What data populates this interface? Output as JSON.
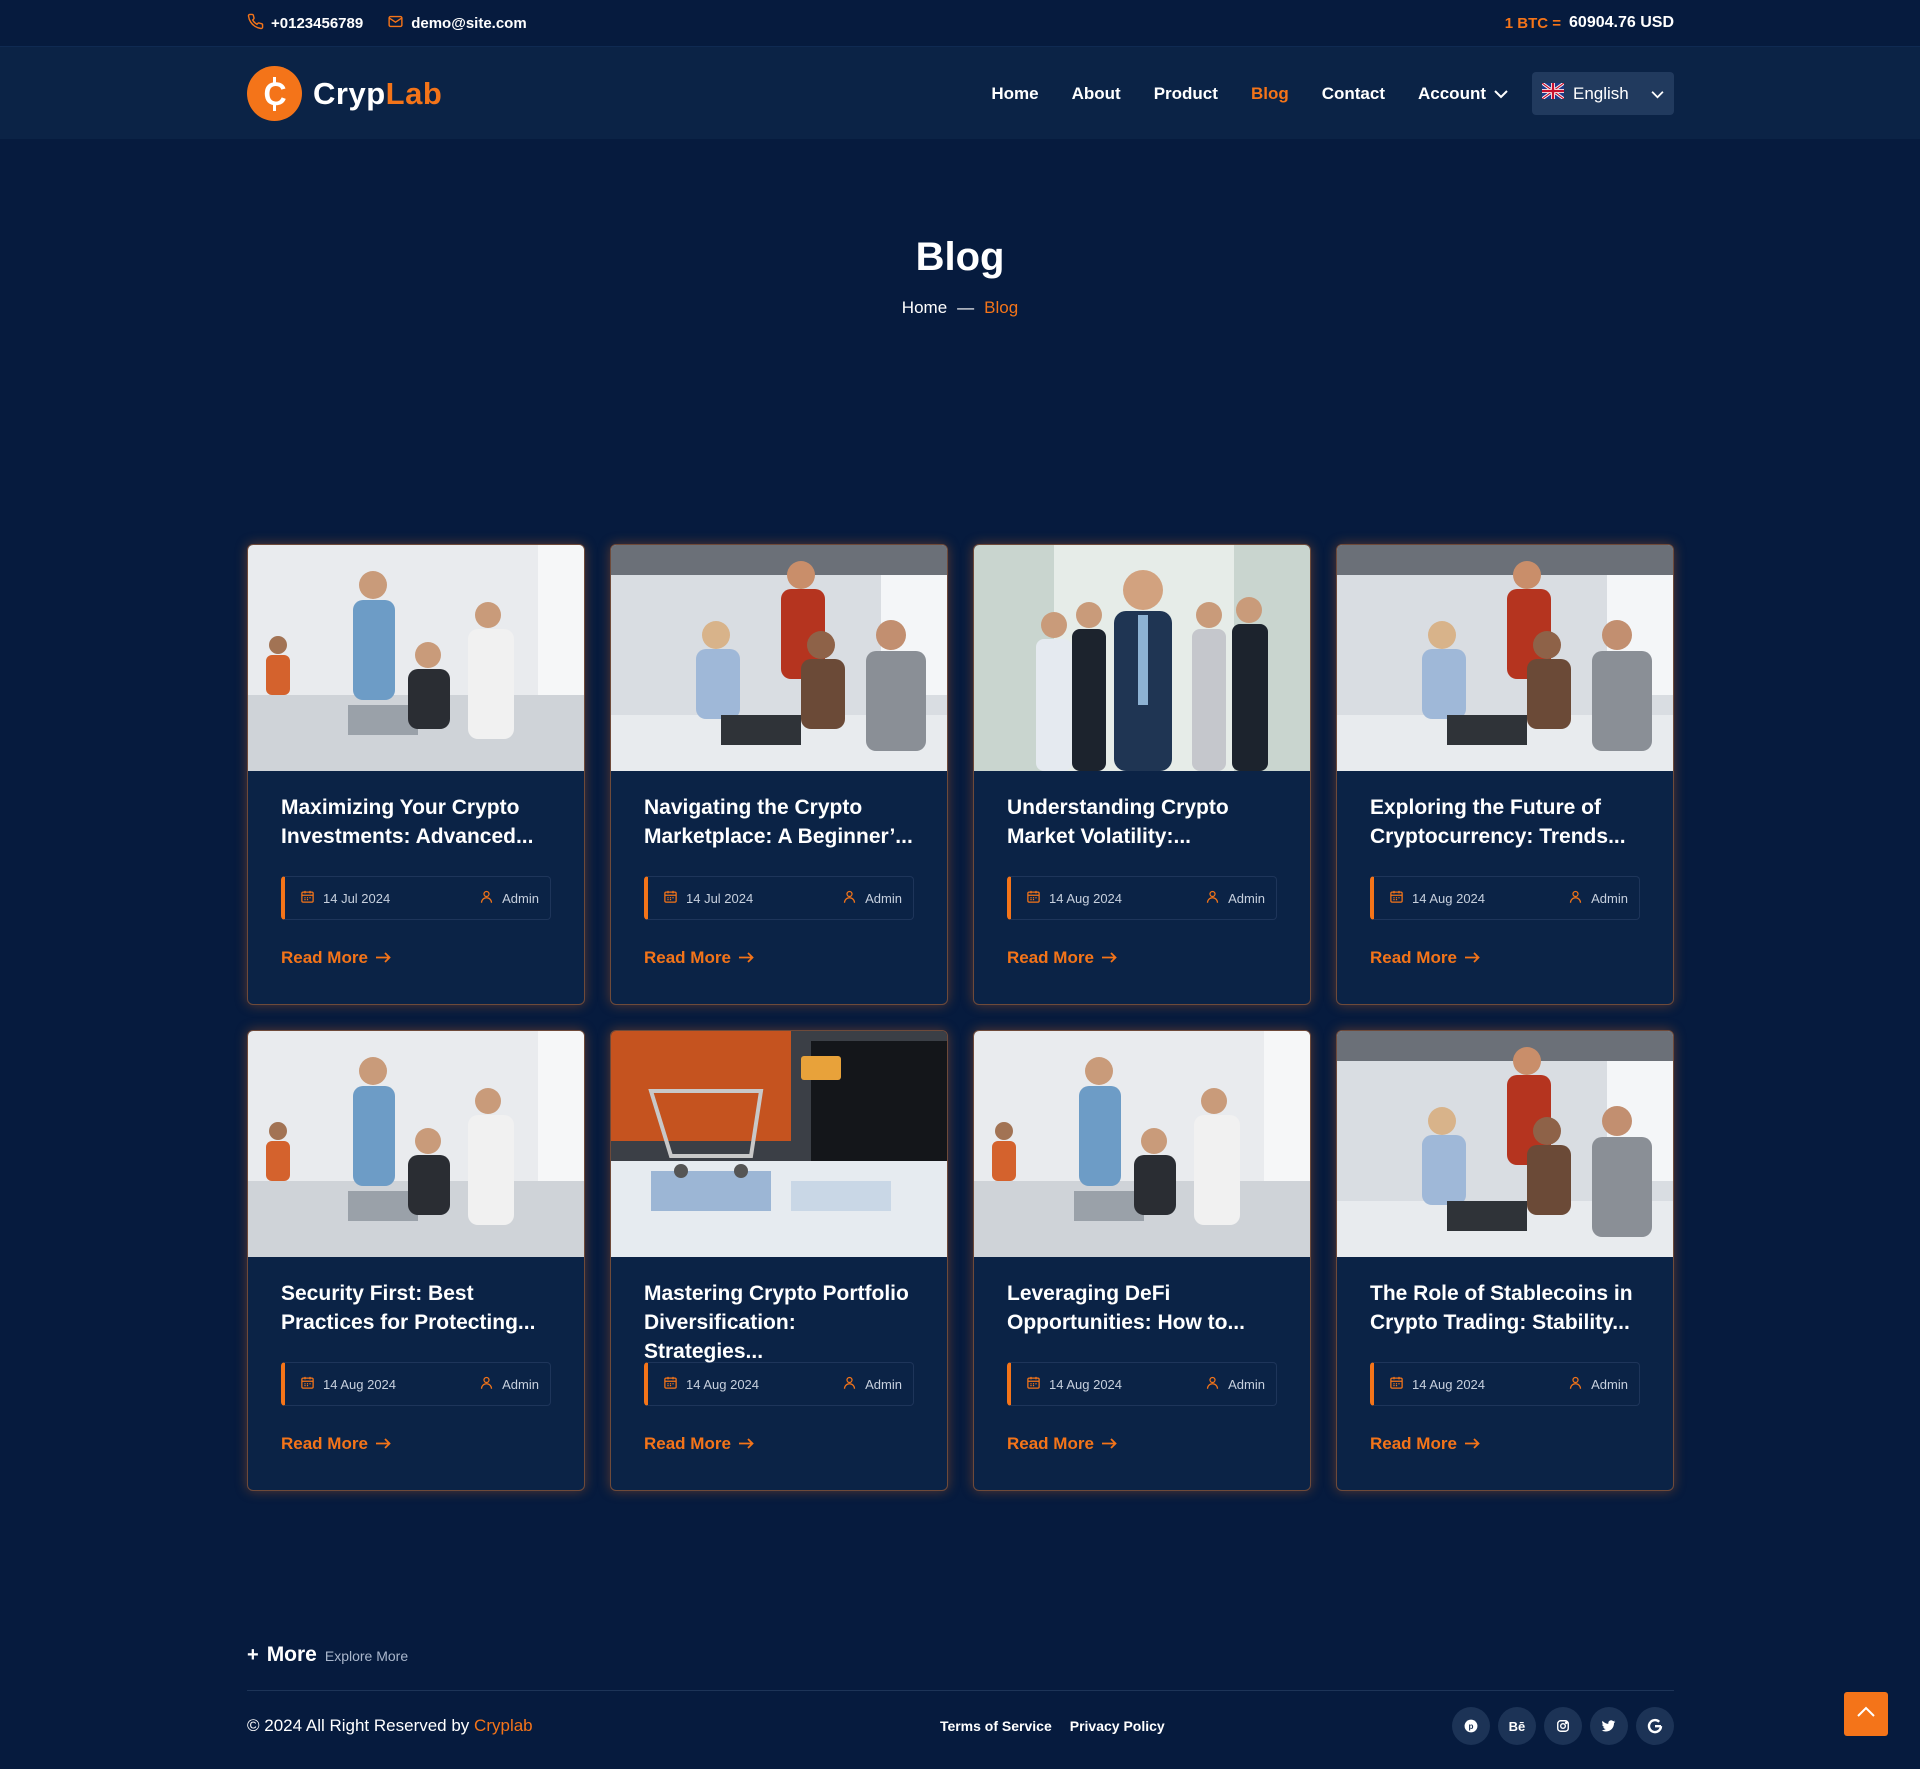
{
  "topbar": {
    "phone": "+0123456789",
    "email": "demo@site.com",
    "btc_label": "1 BTC =",
    "btc_value": "60904.76 USD"
  },
  "header": {
    "logo_part1": "Cryp",
    "logo_part2": "Lab",
    "nav": [
      "Home",
      "About",
      "Product",
      "Blog",
      "Contact",
      "Account"
    ],
    "active_nav": "Blog",
    "language": "English"
  },
  "hero": {
    "title": "Blog",
    "crumb_home": "Home",
    "crumb_sep": "—",
    "crumb_current": "Blog"
  },
  "posts": [
    {
      "title": "Maximizing Your Crypto Investments: Advanced...",
      "date": "14 Jul 2024",
      "author": "Admin",
      "read_more": "Read More"
    },
    {
      "title": "Navigating the Crypto Marketplace: A Beginner’...",
      "date": "14 Jul 2024",
      "author": "Admin",
      "read_more": "Read More"
    },
    {
      "title": "Understanding Crypto Market Volatility:...",
      "date": "14 Aug 2024",
      "author": "Admin",
      "read_more": "Read More"
    },
    {
      "title": "Exploring the Future of Cryptocurrency: Trends...",
      "date": "14 Aug 2024",
      "author": "Admin",
      "read_more": "Read More"
    },
    {
      "title": "Security First: Best Practices for Protecting...",
      "date": "14 Aug 2024",
      "author": "Admin",
      "read_more": "Read More"
    },
    {
      "title": "Mastering Crypto Portfolio Diversification: Strategies...",
      "date": "14 Aug 2024",
      "author": "Admin",
      "read_more": "Read More"
    },
    {
      "title": "Leveraging DeFi Opportunities: How to...",
      "date": "14 Aug 2024",
      "author": "Admin",
      "read_more": "Read More"
    },
    {
      "title": "The Role of Stablecoins in Crypto Trading: Stability...",
      "date": "14 Aug 2024",
      "author": "Admin",
      "read_more": "Read More"
    }
  ],
  "footer": {
    "more_plus": "+",
    "more_label": "More",
    "more_sub": "Explore More",
    "copyright": "© 2024 All Right Reserved by",
    "brand": "Cryplab",
    "links": [
      "Terms of Service",
      "Privacy Policy"
    ],
    "socials": [
      "pinterest-icon",
      "behance-icon",
      "instagram-icon",
      "twitter-icon",
      "google-icon"
    ],
    "behance_text": "Bē"
  },
  "colors": {
    "accent": "#f47419",
    "bg": "#061b3e",
    "card": "#0b2346"
  }
}
